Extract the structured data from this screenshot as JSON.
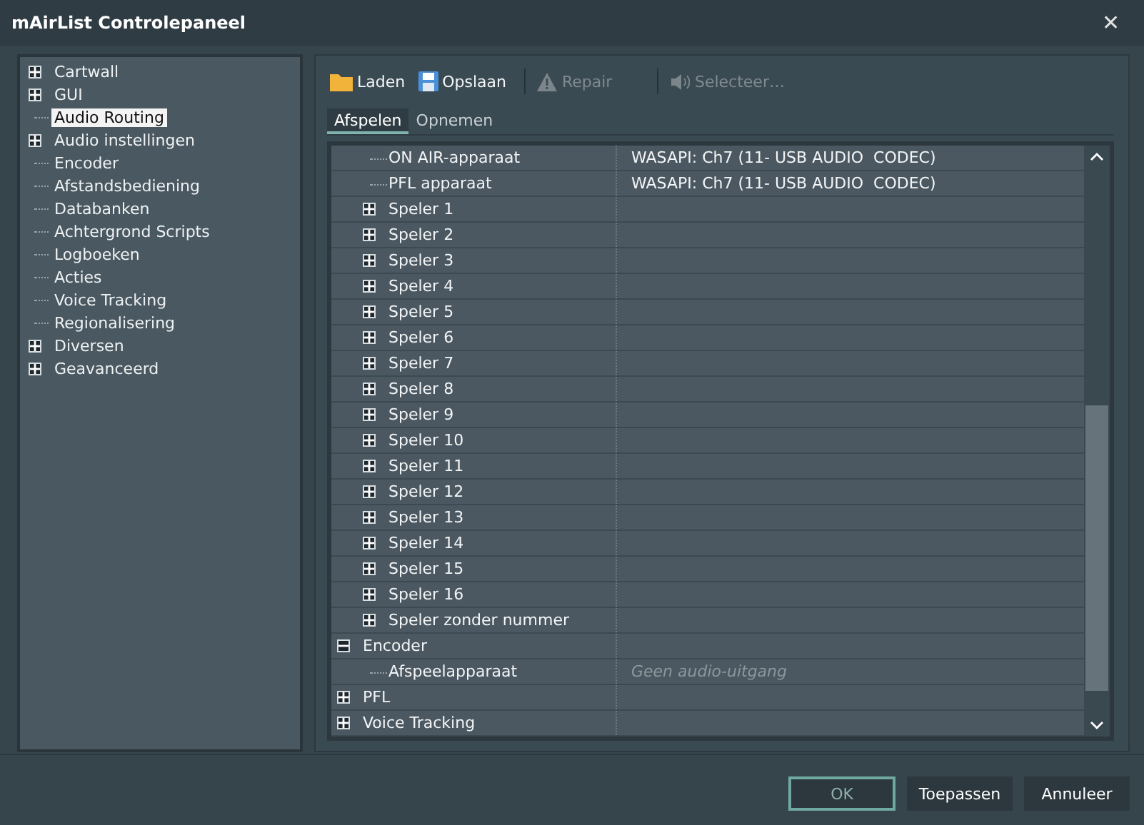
{
  "window": {
    "title": "mAirList Controlepaneel",
    "close": "✕"
  },
  "sidebar": {
    "items": [
      {
        "label": "Cartwall",
        "expanded": false,
        "selected": false
      },
      {
        "label": "GUI",
        "expanded": false,
        "selected": false
      },
      {
        "label": "Audio Routing",
        "selected": true
      },
      {
        "label": "Audio instellingen",
        "expanded": false,
        "selected": false
      },
      {
        "label": "Encoder",
        "selected": false
      },
      {
        "label": "Afstandsbediening",
        "selected": false
      },
      {
        "label": "Databanken",
        "selected": false
      },
      {
        "label": "Achtergrond Scripts",
        "selected": false
      },
      {
        "label": "Logboeken",
        "selected": false
      },
      {
        "label": "Acties",
        "selected": false
      },
      {
        "label": "Voice Tracking",
        "selected": false
      },
      {
        "label": "Regionalisering",
        "selected": false
      },
      {
        "label": "Diversen",
        "expanded": false,
        "selected": false
      },
      {
        "label": "Geavanceerd",
        "expanded": false,
        "selected": false
      }
    ]
  },
  "toolbar": [
    {
      "label": "Laden",
      "kind": "folder",
      "disabled": false
    },
    {
      "label": "Opslaan",
      "kind": "save",
      "disabled": false
    },
    {
      "label": "Repair",
      "kind": "warning",
      "disabled": true
    },
    {
      "label": "Selecteer…",
      "kind": "speaker",
      "disabled": true
    }
  ],
  "tabs": [
    {
      "label": "Afspelen",
      "selected": true
    },
    {
      "label": "Opnemen",
      "selected": false
    }
  ],
  "grid": {
    "rows": [
      {
        "children": [
          {
            "label": "ON AIR-apparaat",
            "value": "WASAPI: Ch7 (11- USB AUDIO  CODEC)"
          },
          {
            "label": "PFL apparaat",
            "value": "WASAPI: Ch7 (11- USB AUDIO  CODEC)"
          },
          {
            "label": "Speler 1",
            "expanded": false
          },
          {
            "label": "Speler 2",
            "expanded": false
          },
          {
            "label": "Speler 3",
            "expanded": false
          },
          {
            "label": "Speler 4",
            "expanded": false
          },
          {
            "label": "Speler 5",
            "expanded": false
          },
          {
            "label": "Speler 6",
            "expanded": false
          },
          {
            "label": "Speler 7",
            "expanded": false
          },
          {
            "label": "Speler 8",
            "expanded": false
          },
          {
            "label": "Speler 9",
            "expanded": false
          },
          {
            "label": "Speler 10",
            "expanded": false
          },
          {
            "label": "Speler 11",
            "expanded": false
          },
          {
            "label": "Speler 12",
            "expanded": false
          },
          {
            "label": "Speler 13",
            "expanded": false
          },
          {
            "label": "Speler 14",
            "expanded": false
          },
          {
            "label": "Speler 15",
            "expanded": false
          },
          {
            "label": "Speler 16",
            "expanded": false
          },
          {
            "label": "Speler zonder nummer",
            "expanded": false
          }
        ]
      },
      {
        "label": "Encoder",
        "expanded": true,
        "children": [
          {
            "label": "Afspeelapparaat",
            "placeholder": "Geen audio-uitgang"
          }
        ]
      },
      {
        "label": "PFL",
        "expanded": false
      },
      {
        "label": "Voice Tracking",
        "expanded": false
      }
    ]
  },
  "buttons": [
    {
      "label": "OK",
      "focused": true
    },
    {
      "label": "Toepassen",
      "focused": false
    },
    {
      "label": "Annuleer",
      "focused": false
    }
  ]
}
